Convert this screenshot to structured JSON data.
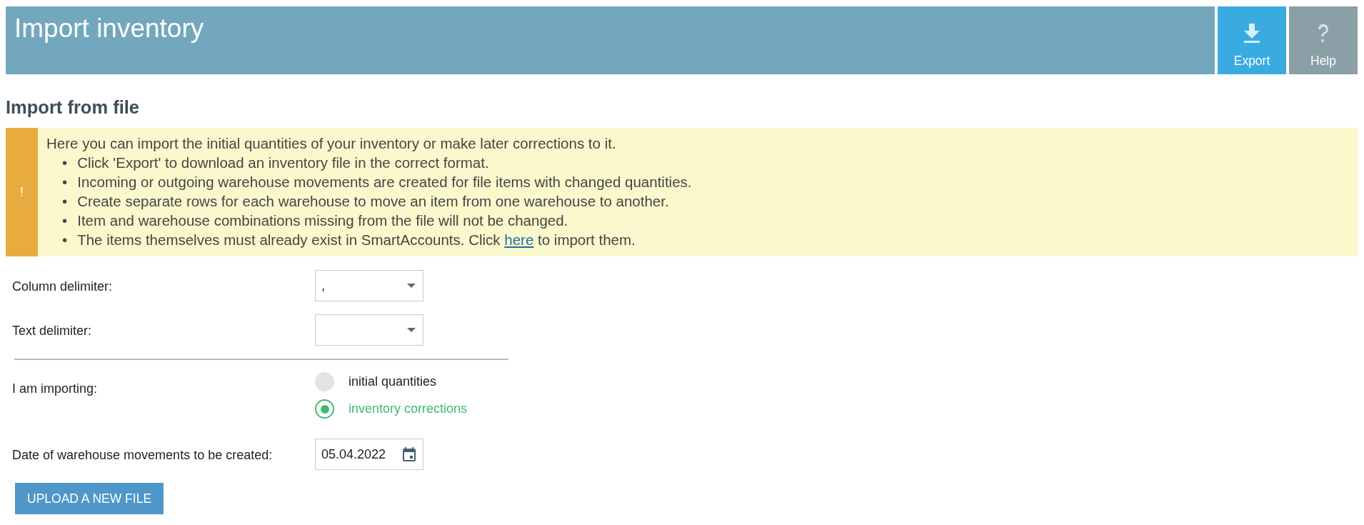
{
  "header": {
    "title": "Import inventory",
    "buttons": [
      {
        "kind": "export",
        "label": "Export"
      },
      {
        "kind": "help",
        "label": "Help"
      }
    ]
  },
  "section_title": "Import from file",
  "notice": {
    "icon": "!",
    "intro": "Here you can import the initial quantities of your inventory or make later corrections to it.",
    "items": [
      {
        "bullet": "•",
        "text": "Click 'Export' to download an inventory file in the correct format."
      },
      {
        "bullet": "•",
        "text": "Incoming or outgoing warehouse movements are created for file items with changed quantities."
      },
      {
        "bullet": "•",
        "text": "Create separate rows for each warehouse to move an item from one warehouse to another."
      },
      {
        "bullet": "•",
        "text": "Item and warehouse combinations missing from the file will not be changed."
      },
      {
        "bullet": "•",
        "text": "The items themselves must already exist in SmartAccounts. Click",
        "link": "here",
        "after": "to import them."
      }
    ]
  },
  "form": {
    "fields": [
      {
        "kind": "select",
        "label": "Column delimiter:",
        "value": ","
      },
      {
        "kind": "select",
        "label": "Text delimiter:"
      },
      {
        "kind": "radio",
        "label": "I am importing:",
        "options": [
          {
            "label": "initial quantities",
            "selected": false
          },
          {
            "label": "inventory corrections",
            "selected": true
          }
        ]
      },
      {
        "kind": "date",
        "label": "Date of warehouse movements to be created:",
        "value": "05.04.2022"
      }
    ],
    "upload_button": "UPLOAD A NEW FILE"
  }
}
